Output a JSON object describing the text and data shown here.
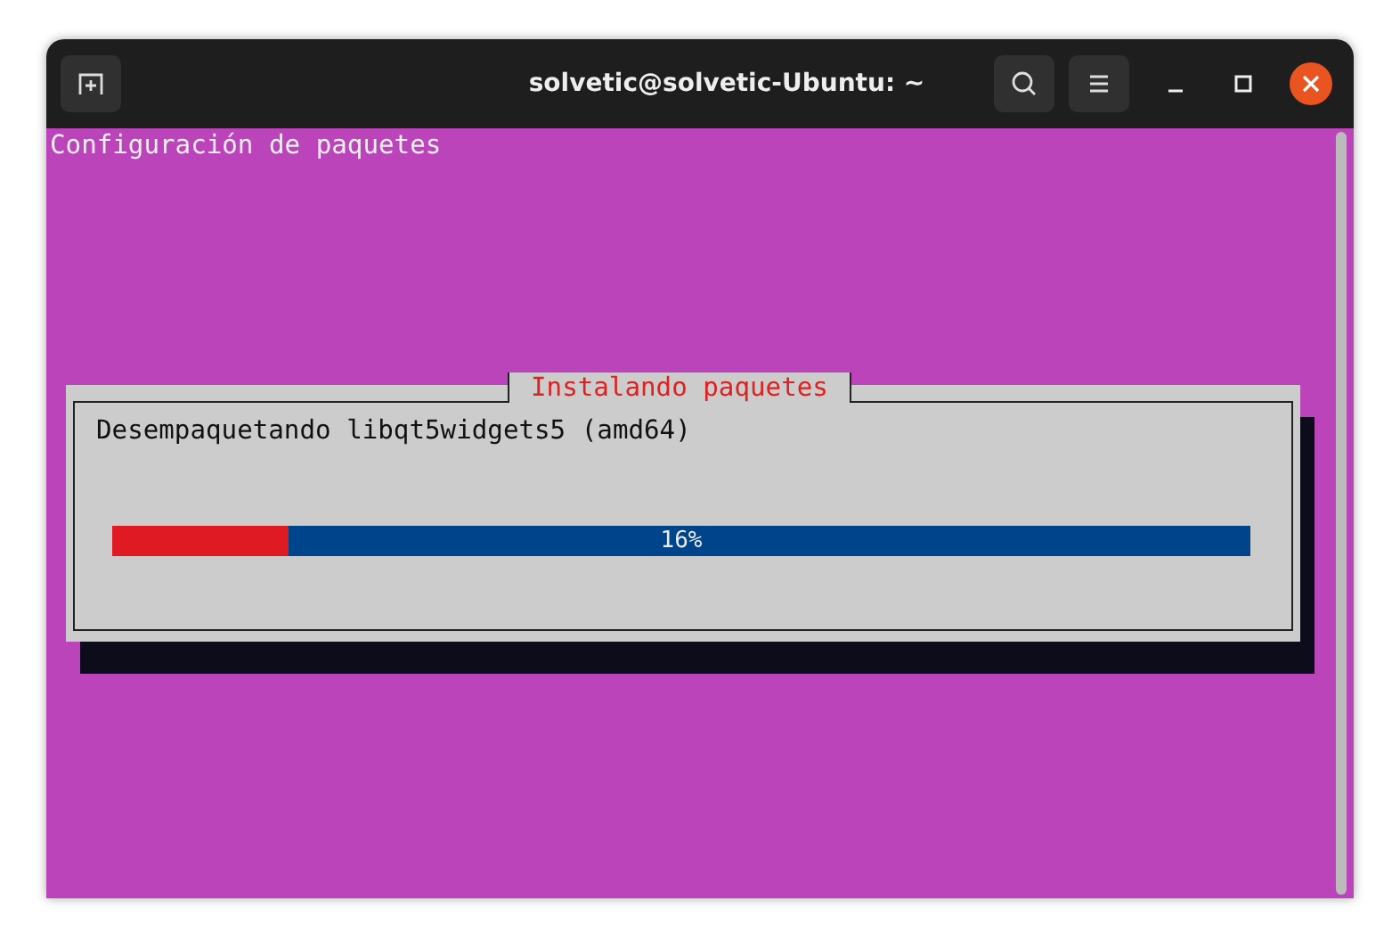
{
  "window": {
    "title": "solvetic@solvetic-Ubuntu: ~"
  },
  "terminal": {
    "header": "Configuración de paquetes"
  },
  "dialog": {
    "title": "Instalando paquetes",
    "message": "Desempaquetando libqt5widgets5 (amd64)",
    "progress": {
      "level": 0.155,
      "reading": "16%"
    }
  }
}
